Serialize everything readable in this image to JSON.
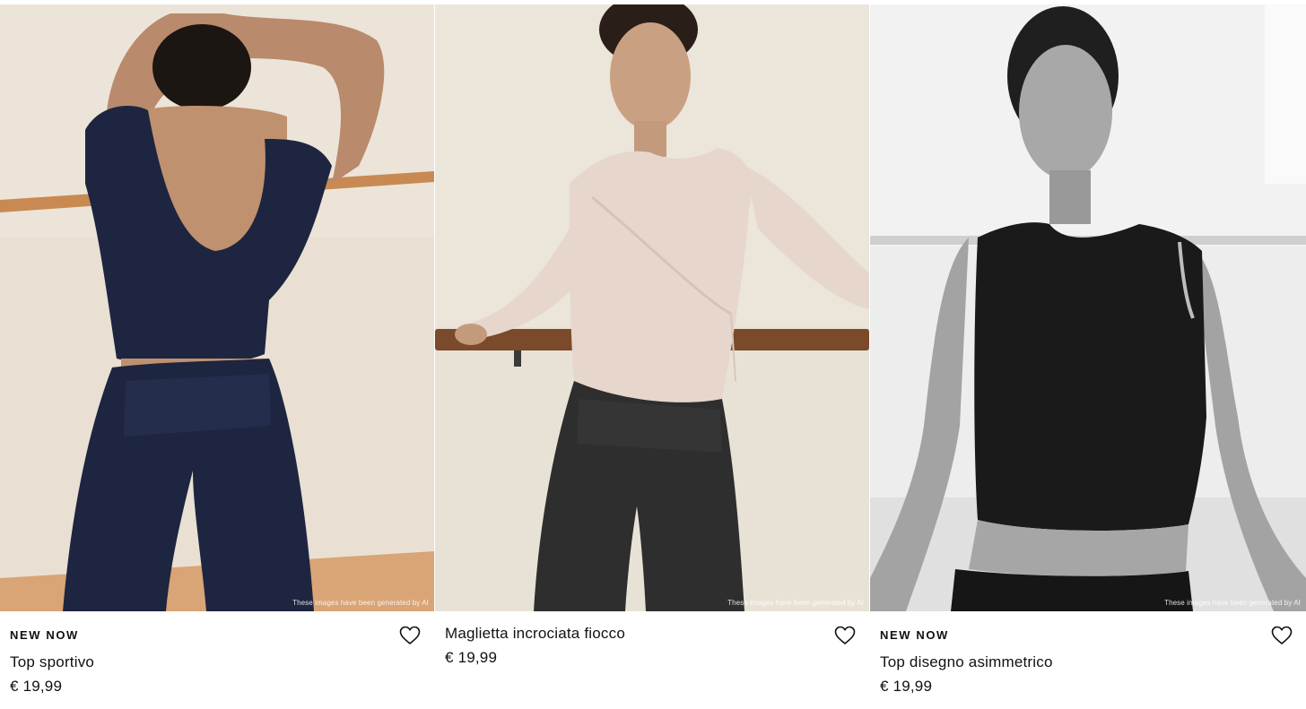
{
  "products": [
    {
      "badge": "NEW NOW",
      "name": "Top sportivo",
      "price": "€ 19,99",
      "ai_note": "These images have been generated by AI",
      "wishlist_icon": "heart-outline-icon"
    },
    {
      "badge": "",
      "name": "Maglietta incrociata fiocco",
      "price": "€ 19,99",
      "ai_note": "These images have been generated by AI",
      "wishlist_icon": "heart-outline-icon"
    },
    {
      "badge": "NEW NOW",
      "name": "Top disegno asimmetrico",
      "price": "€ 19,99",
      "ai_note": "These images have been generated by AI",
      "wishlist_icon": "heart-outline-icon"
    }
  ],
  "colors": {
    "text": "#111111",
    "background": "#ffffff",
    "navy_garment": "#1e2540",
    "blush_garment": "#e6d6cc",
    "black_garment": "#1a1a1a"
  }
}
